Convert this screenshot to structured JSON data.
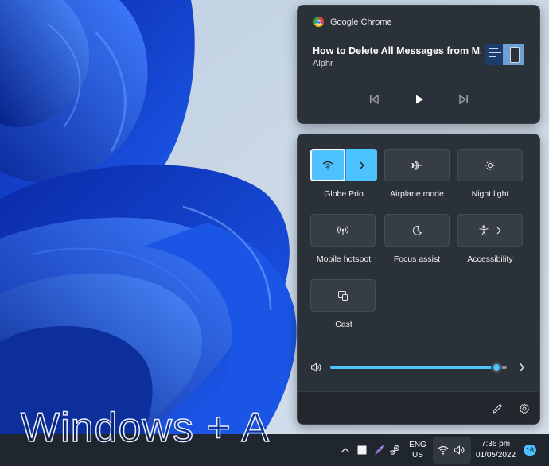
{
  "overlay_caption": "Windows + A",
  "media": {
    "app_name": "Google Chrome",
    "app_icon": "chrome-icon",
    "title": "How to Delete All Messages from M...",
    "artist": "Alphr",
    "controls": [
      "previous-icon",
      "play-icon",
      "next-icon"
    ]
  },
  "quick_settings": {
    "tiles": [
      {
        "label": "Globe Prio",
        "icon": "wifi-icon",
        "active": true
      },
      {
        "label": "Airplane mode",
        "icon": "airplane-icon",
        "active": false
      },
      {
        "label": "Night light",
        "icon": "brightness-icon",
        "active": false
      },
      {
        "label": "Mobile hotspot",
        "icon": "hotspot-icon",
        "active": false
      },
      {
        "label": "Focus assist",
        "icon": "moon-icon",
        "active": false
      },
      {
        "label": "Accessibility",
        "icon": "accessibility-icon",
        "active": false
      },
      {
        "label": "Cast",
        "icon": "cast-icon",
        "active": false
      }
    ],
    "volume_level": 0.94,
    "footer_icons": [
      "edit-icon",
      "settings-icon"
    ]
  },
  "taskbar": {
    "language_line1": "ENG",
    "language_line2": "US",
    "time": "7:36 pm",
    "date": "01/05/2022",
    "notification_count": "16"
  },
  "colors": {
    "accent": "#4cc2ff",
    "panel": "#2b3138",
    "taskbar": "#1f262d",
    "wallpaper_blue": "#1448d8"
  }
}
